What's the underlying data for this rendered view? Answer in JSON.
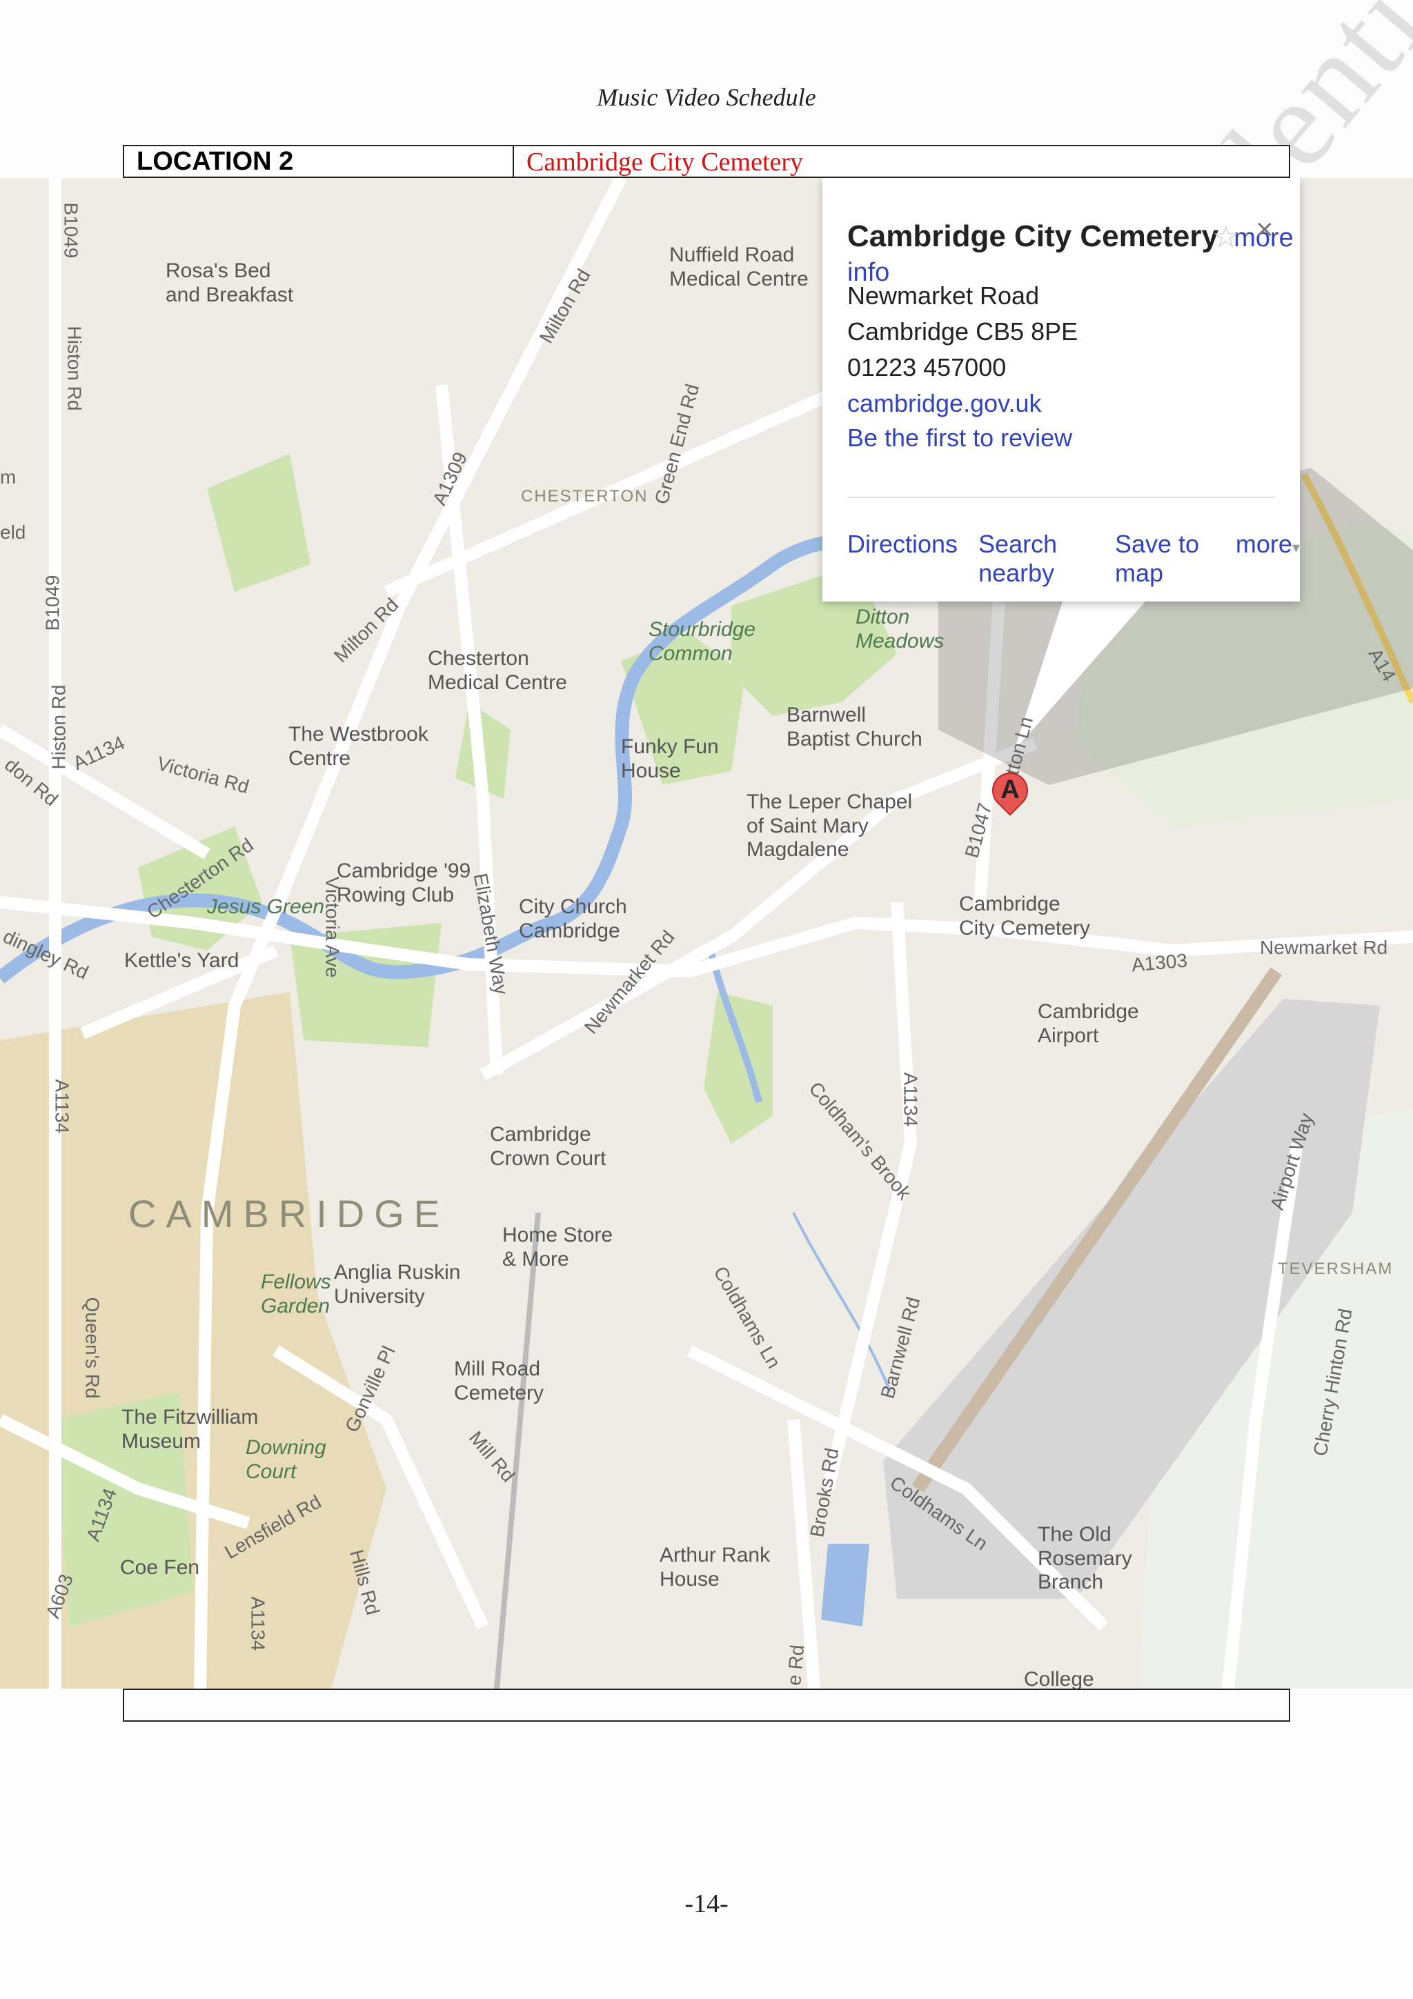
{
  "header": {
    "title": "Music Video Schedule"
  },
  "watermark": "Confidential",
  "location": {
    "label": "LOCATION 2",
    "value": "Cambridge City Cemetery"
  },
  "map": {
    "infobox": {
      "title": "Cambridge City Cemetery",
      "more_info": "more info",
      "address_line1": "Newmarket Road",
      "address_line2": "Cambridge CB5 8PE",
      "phone": "01223 457000",
      "website": "cambridge.gov.uk",
      "review": "Be the first to review",
      "actions": [
        "Directions",
        "Search nearby",
        "Save to map",
        "more"
      ]
    },
    "marker_letter": "A",
    "places": {
      "rosas": "Rosa's Bed\nand Breakfast",
      "nuffield": "Nuffield Road\nMedical Centre",
      "chesterton": "CHESTERTON",
      "stourbridge": "Stourbridge\nCommon",
      "ditton": "Ditton\nMeadows",
      "chesterton_med": "Chesterton\nMedical Centre",
      "westbrook": "The Westbrook\nCentre",
      "barnwell": "Barnwell\nBaptist Church",
      "funky": "Funky Fun\nHouse",
      "leper": "The Leper Chapel\nof Saint Mary\nMagdalene",
      "cemetery": "Cambridge\nCity Cemetery",
      "rowing": "Cambridge '99\nRowing Club",
      "jesus": "Jesus Green",
      "city_church": "City Church\nCambridge",
      "kettles": "Kettle's Yard",
      "airport": "Cambridge\nAirport",
      "crown": "Cambridge\nCrown Court",
      "cambridge": "CAMBRIDGE",
      "home_store": "Home Store\n& More",
      "teversham": "TEVERSHAM",
      "fellows": "Fellows\nGarden",
      "anglia": "Anglia Ruskin\nUniversity",
      "mill_road": "Mill Road\nCemetery",
      "fitzwilliam": "The Fitzwilliam\nMuseum",
      "downing": "Downing\nCourt",
      "coe_fen": "Coe Fen",
      "arthur": "Arthur Rank\nHouse",
      "old_rosemary": "The Old\nRosemary\nBranch",
      "college": "College"
    },
    "roads": {
      "b1049_top": "B1049",
      "histon1": "Histon Rd",
      "milton_top": "Milton Rd",
      "green_end": "Green End Rd",
      "a1309": "A1309",
      "b1049_mid": "B1049",
      "milton_mid": "Milton Rd",
      "histon2": "Histon Rd",
      "a1134_left": "A1134",
      "victoria_rd": "Victoria Rd",
      "chesterton_rd": "Chesterton Rd",
      "victoria_ave": "Victoria Ave",
      "elizabeth": "Elizabeth Way",
      "newmarket_rd": "Newmarket Rd",
      "b1047": "B1047",
      "ditton_ln": "Ditton Ln",
      "a1303": "A1303",
      "newmarket_rd_right": "Newmarket Rd",
      "a14": "A14",
      "a1134_vert": "A1134",
      "coldhams_brook": "Coldham's Brook",
      "airport_way": "Airport Way",
      "coldhams_ln": "Coldhams Ln",
      "barnwell_rd": "Barnwell Rd",
      "queens_rd": "Queen's Rd",
      "gonville": "Gonville Pl",
      "mill_rd": "Mill Rd",
      "cherry_hinton": "Cherry Hinton Rd",
      "brooks_rd": "Brooks Rd",
      "coldhams_ln2": "Coldhams Ln",
      "a1134_bottom": "A1134",
      "lensfield": "Lensfield Rd",
      "hills_rd": "Hills Rd",
      "a603": "A603",
      "a1134_b2": "A1134",
      "dingley": "dingley Rd",
      "a1134_lower_left": "A1134",
      "don_rd": "don Rd",
      "eld": "eld",
      "m": "m",
      "e_rd": "e Rd"
    }
  },
  "page_number": "-14-"
}
